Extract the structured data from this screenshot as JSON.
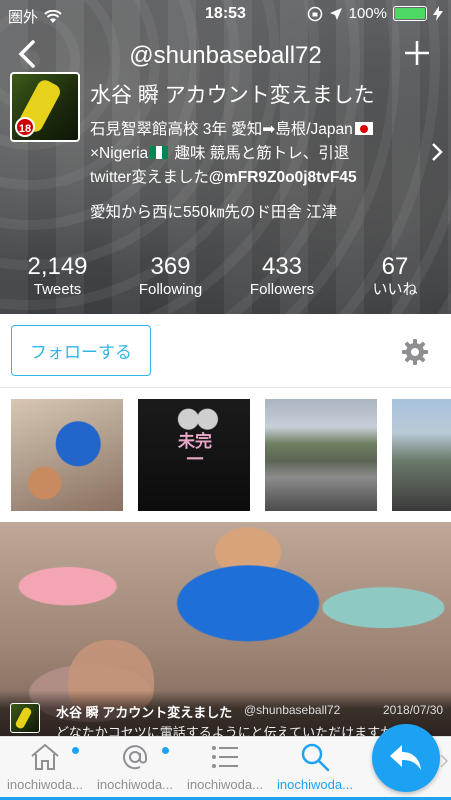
{
  "status_bar": {
    "carrier": "圏外",
    "time": "18:53",
    "battery": "100%",
    "battery_level": 1.0
  },
  "header": {
    "handle": "@shunbaseball72",
    "display_name": "水谷 瞬 アカウント変えました",
    "avatar_badge": "18",
    "bio": {
      "line1": "石見智翠館高校 3年 愛知➡島根/Japan",
      "line2_a": "×Nigeria",
      "line2_b": " 趣味 競馬と筋トレ、引退",
      "line3_a": "twitter変えました",
      "line3_b": "@mFR9Z0o0j8tvF45"
    },
    "location": "愛知から西に550㎞先のド田舎 江津"
  },
  "stats": [
    {
      "num": "2,149",
      "label": "Tweets"
    },
    {
      "num": "369",
      "label": "Following"
    },
    {
      "num": "433",
      "label": "Followers"
    },
    {
      "num": "67",
      "label": "いいね"
    }
  ],
  "follow_bar": {
    "follow_label": "フォローする"
  },
  "media_thumbs": {
    "t2_kanji": "未完一"
  },
  "tweet": {
    "name": "水谷 瞬 アカウント変えました",
    "handle": "@shunbaseball72",
    "date": "2018/07/30",
    "text": "どなたかコセツに電話するようにと伝えていただけますか？"
  },
  "tabs": [
    {
      "label": "inochiwoda...",
      "icon": "home-icon"
    },
    {
      "label": "inochiwoda...",
      "icon": "at-icon"
    },
    {
      "label": "inochiwoda...",
      "icon": "list-icon"
    },
    {
      "label": "inochiwoda...",
      "icon": "search-icon",
      "active": true
    }
  ],
  "colors": {
    "accent": "#1da1f2",
    "follow": "#33b5e5",
    "battery": "#4cd964"
  }
}
